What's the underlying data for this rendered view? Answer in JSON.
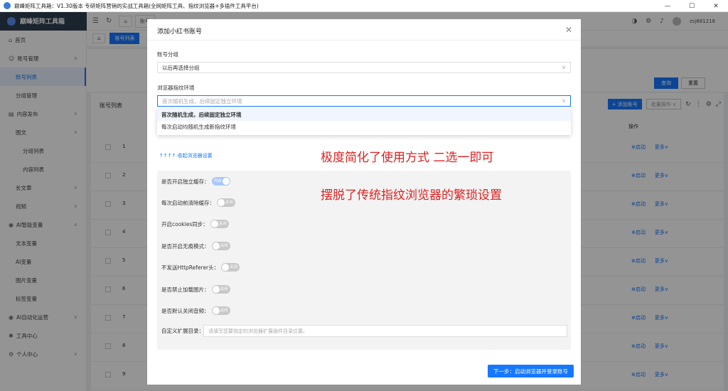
{
  "window": {
    "title": "巅峰矩阵工具箱：V1.30版本  专研矩阵营销的实战工具箱(全网矩阵工具、指纹浏览器+多插件工具平台)",
    "min": "—",
    "max": "☐",
    "close": "✕"
  },
  "header": {
    "logo": "巅峰矩阵工具箱",
    "tab1": "账号",
    "user": "zsj881218"
  },
  "sidebar": {
    "items": [
      {
        "label": "首页",
        "icon": "⌂"
      },
      {
        "label": "账号管理",
        "icon": "☺"
      },
      {
        "label": "账号列表"
      },
      {
        "label": "分组管理"
      },
      {
        "label": "内容发布",
        "icon": "▤"
      },
      {
        "label": "图文"
      },
      {
        "label": "分组列表"
      },
      {
        "label": "内容列表"
      },
      {
        "label": "长文章"
      },
      {
        "label": "视频"
      },
      {
        "label": "AI智能变量",
        "icon": "◉"
      },
      {
        "label": "文本变量"
      },
      {
        "label": "AI变量"
      },
      {
        "label": "图片变量"
      },
      {
        "label": "标签变量"
      },
      {
        "label": "AI自动化运营",
        "icon": "◉"
      },
      {
        "label": "工具中心",
        "icon": "✱"
      },
      {
        "label": "个人中心",
        "icon": "⚙"
      }
    ]
  },
  "main": {
    "tab_list": "账号列表",
    "query": "查询",
    "reset": "重置",
    "list_title": "账号列表",
    "add": "+ 添加账号",
    "batch": "批量操作 ∨",
    "col_op": "操作",
    "launch": "⊕启动",
    "more": "更多∨",
    "rows": [
      "1",
      "2",
      "3",
      "4",
      "5",
      "6",
      "7",
      "8",
      "9"
    ]
  },
  "modal": {
    "title": "添加小红书账号",
    "group_label": "账号分组",
    "group_value": "以后再选择分组",
    "env_label": "浏览器指纹环境",
    "env_placeholder": "首次随机生成，后续固定独立环境",
    "options": [
      "首次随机生成，后续固定独立环境",
      "每次启动均随机生成新指纹环境"
    ],
    "collapse": "↑↑↑↑ 收起浏览器设置",
    "annot1": "极度简化了使用方式 二选一即可",
    "annot2": "摆脱了传统指纹浏览器的繁琐设置",
    "settings": [
      {
        "label": "是否开启独立缓存：",
        "state": "开启",
        "on": true
      },
      {
        "label": "每次启动前清除缓存：",
        "state": "关闭",
        "on": false
      },
      {
        "label": "开启cookies同步：",
        "state": "关闭",
        "on": false
      },
      {
        "label": "是否开启无痕模式：",
        "state": "关闭",
        "on": false
      },
      {
        "label": "不发送HttpReferer头：",
        "state": "关闭",
        "on": false
      },
      {
        "label": "是否禁止加载图片：",
        "state": "关闭",
        "on": false
      },
      {
        "label": "是否默认关闭音频：",
        "state": "关闭",
        "on": false
      }
    ],
    "ext_label": "自定义扩展目录：",
    "ext_placeholder": "请填写您要指定的浏览器扩展插件目录位置。",
    "next": "下一步：启动浏览器并登录账号"
  }
}
